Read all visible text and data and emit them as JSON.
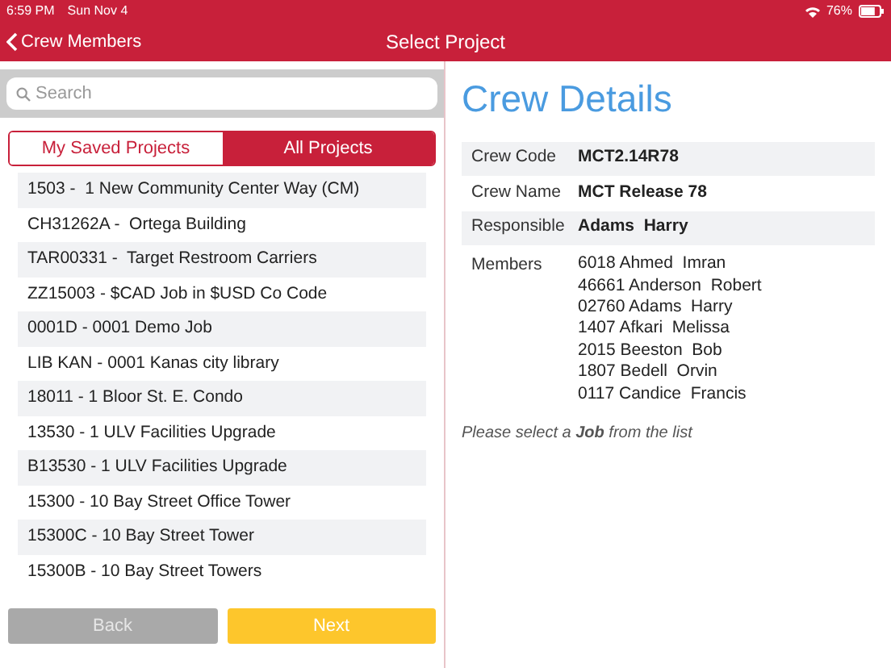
{
  "status_bar": {
    "time": "6:59 PM",
    "date": "Sun Nov 4",
    "battery_text": "76%"
  },
  "nav_bar": {
    "back_label": "Crew Members",
    "title": "Select Project"
  },
  "search": {
    "placeholder": "Search"
  },
  "segments": [
    {
      "label": "My Saved Projects",
      "selected": false
    },
    {
      "label": "All Projects",
      "selected": true
    }
  ],
  "projects": [
    "1503 -  1 New Community Center Way (CM)",
    "CH31262A -  Ortega Building",
    "TAR00331 -  Target Restroom Carriers",
    "ZZ15003 - $CAD Job in $USD Co Code",
    "0001D - 0001 Demo Job",
    "LIB KAN - 0001 Kanas city library",
    "18011 - 1 Bloor St. E. Condo",
    "13530 - 1 ULV Facilities Upgrade",
    "B13530 - 1 ULV Facilities Upgrade",
    "15300 - 10 Bay Street Office Tower",
    "15300C - 10 Bay Street Tower",
    "15300B - 10 Bay Street Towers"
  ],
  "buttons": [
    {
      "label": "Back",
      "kind": "secondary",
      "disabled": true
    },
    {
      "label": "Next",
      "kind": "primary",
      "disabled": false
    }
  ],
  "crew_details": {
    "title": "Crew Details",
    "fields": [
      {
        "label": "Crew Code",
        "value": "MCT2.14R78"
      },
      {
        "label": "Crew Name",
        "value": "MCT Release 78"
      },
      {
        "label": "Responsible",
        "value": "Adams  Harry"
      }
    ],
    "members_label": "Members",
    "members": [
      "6018 Ahmed  Imran",
      "46661 Anderson  Robert",
      "02760 Adams  Harry",
      "1407 Afkari  Melissa",
      "2015 Beeston  Bob",
      "1807 Bedell  Orvin",
      "0117 Candice  Francis"
    ],
    "hint": "Please select a **Job** from the list"
  }
}
